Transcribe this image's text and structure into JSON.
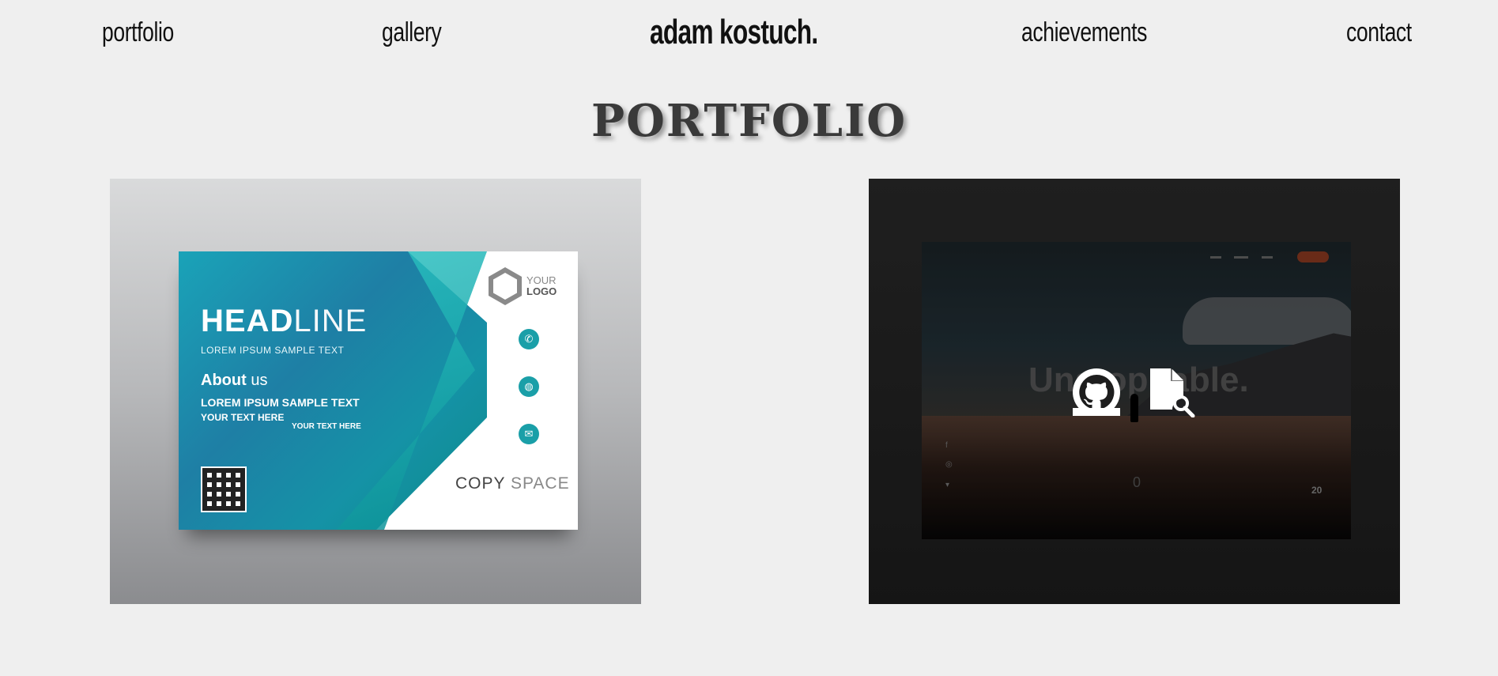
{
  "nav": {
    "left": [
      "portfolio",
      "gallery"
    ],
    "brand": "adam kostuch.",
    "right": [
      "achievements",
      "contact"
    ]
  },
  "main": {
    "title": "PORTFOLIO"
  },
  "cards": [
    {
      "preview": {
        "headline_bold": "HEAD",
        "headline_light": "LINE",
        "sub": "LOREM IPSUM SAMPLE TEXT",
        "about_bold": "About",
        "about_light": " us",
        "lorem": "LOREM IPSUM SAMPLE TEXT",
        "your_text_1": "YOUR TEXT HERE",
        "lorem_small": "LOREM IPSUM SAMPLE TEXT",
        "your_text_2": "YOUR TEXT HERE",
        "logo_line1": "YOUR",
        "logo_line2": "LOGO",
        "copy_bold": "COPY",
        "copy_light": " SPACE"
      }
    },
    {
      "preview": {
        "word": "Unstoppable.",
        "number": "20",
        "zero": "0"
      },
      "actions": {
        "github_icon": "github-icon",
        "document_icon": "document-search-icon"
      }
    }
  ],
  "colors": {
    "background": "#efefef",
    "text": "#111111",
    "title": "#3a3a3a",
    "teal": "#1a9fa8"
  }
}
